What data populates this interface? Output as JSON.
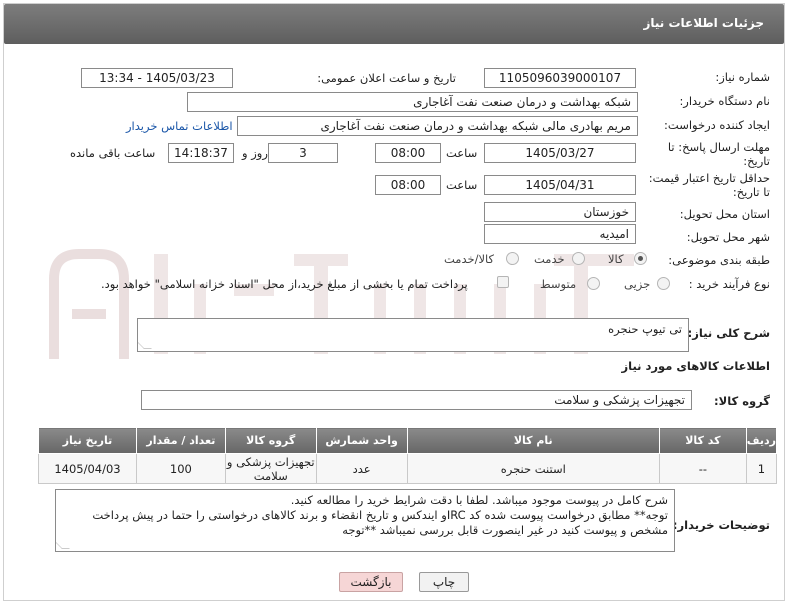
{
  "header": {
    "title": "جزئیات اطلاعات نیاز"
  },
  "fields": {
    "need_number_label": "شماره نیاز:",
    "need_number": "1105096039000107",
    "announce_label": "تاریخ و ساعت اعلان عمومی:",
    "announce_value": "1405/03/23 - 13:34",
    "buyer_org_label": "نام دستگاه خریدار:",
    "buyer_org": "شبکه بهداشت و درمان صنعت نفت آغاجاری",
    "creator_label": "ایجاد کننده درخواست:",
    "creator": "مریم بهادری مالی شبکه بهداشت و درمان صنعت نفت آغاجاری",
    "contact_link": "اطلاعات تماس خریدار",
    "reply_deadline_label_1": "مهلت ارسال پاسخ: تا",
    "reply_deadline_label_2": "تاریخ:",
    "reply_date": "1405/03/27",
    "time_label": "ساعت",
    "reply_time": "08:00",
    "days_value": "3",
    "days_label": "روز و",
    "remaining_time": "14:18:37",
    "remaining_label": "ساعت باقی مانده",
    "validity_label_1": "حداقل تاریخ اعتبار قیمت:",
    "validity_label_2": "تا تاریخ:",
    "validity_date": "1405/04/31",
    "validity_time_label": "ساعت",
    "validity_time": "08:00",
    "province_label": "استان محل تحویل:",
    "province": "خوزستان",
    "city_label": "شهر محل تحویل:",
    "city": "امیدیه",
    "category_label": "طبقه بندی موضوعی:",
    "category_options": [
      "کالا",
      "خدمت",
      "کالا/خدمت"
    ],
    "process_label": "نوع فرآیند خرید :",
    "process_options": [
      "جزیی",
      "متوسط"
    ],
    "payment_note": "پرداخت تمام یا بخشی از مبلغ خرید،از محل \"اسناد خزانه اسلامی\" خواهد بود.",
    "summary_label": "شرح کلی نیاز:",
    "summary": "تی تیوپ حنجره",
    "goods_info_label": "اطلاعات کالاهای مورد نیاز",
    "goods_group_label": "گروه کالا:",
    "goods_group": "تجهیزات پزشکی و سلامت"
  },
  "table": {
    "headers": [
      "ردیف",
      "کد کالا",
      "نام کالا",
      "واحد شمارش",
      "گروه کالا",
      "تعداد / مقدار",
      "تاریخ نیاز"
    ],
    "rows": [
      [
        "1",
        "--",
        "استنت حنجره",
        "عدد",
        "تجهیزات پزشکی و سلامت",
        "100",
        "1405/04/03"
      ]
    ]
  },
  "buyer_notes": {
    "label": "توضیحات خریدار:",
    "lines": [
      "شرح کامل در پیوست موجود میباشد. لطفا با دقت شرایط خرید را مطالعه کنید.",
      "توجه** مطابق درخواست پیوست شده کد IRCو ایندکس و تاریخ انقضاء و برند کالاهای درخواستی را حتما در پیش پرداخت",
      "مشخص و پیوست کنید در غیر اینصورت قابل بررسی نمیباشد **توجه"
    ]
  },
  "buttons": {
    "print": "چاپ",
    "back": "بازگشت"
  },
  "colors": {
    "header": "#6e6e6e",
    "back_button": "#f6d6d6",
    "print_button": "#f2f2f2",
    "link": "#1a56a8"
  }
}
